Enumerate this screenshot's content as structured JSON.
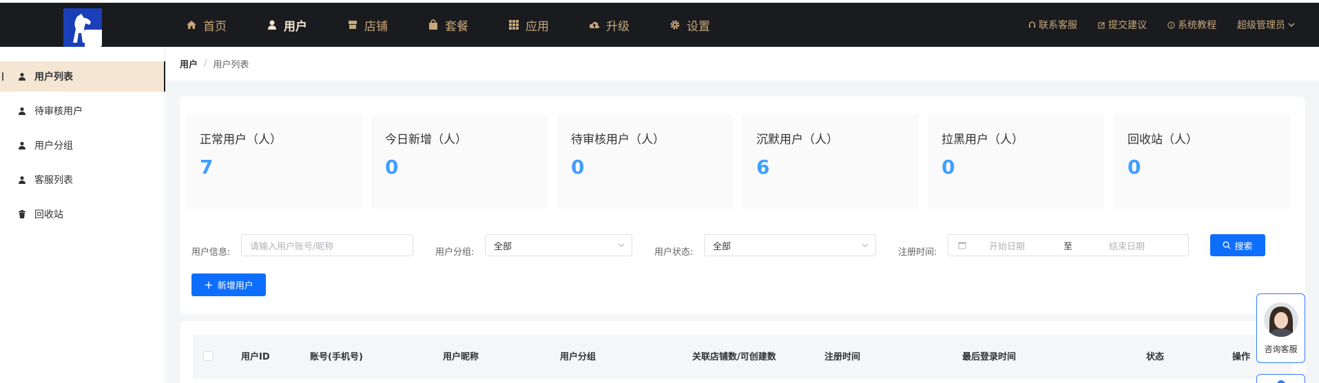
{
  "nav": {
    "items": [
      {
        "label": "首页",
        "icon": "home-icon"
      },
      {
        "label": "用户",
        "icon": "user-icon",
        "active": true
      },
      {
        "label": "店铺",
        "icon": "shop-icon"
      },
      {
        "label": "套餐",
        "icon": "package-icon"
      },
      {
        "label": "应用",
        "icon": "apps-grid-icon"
      },
      {
        "label": "升级",
        "icon": "cloud-upload-icon"
      },
      {
        "label": "设置",
        "icon": "gear-icon"
      }
    ],
    "right": [
      {
        "label": "联系客服",
        "icon": "headset-icon"
      },
      {
        "label": "提交建议",
        "icon": "edit-icon"
      },
      {
        "label": "系统教程",
        "icon": "info-icon"
      }
    ],
    "admin": "超级管理员"
  },
  "sidebar": {
    "items": [
      {
        "label": "用户列表",
        "icon": "user-icon",
        "active": true
      },
      {
        "label": "待审核用户",
        "icon": "user-icon"
      },
      {
        "label": "用户分组",
        "icon": "user-icon"
      },
      {
        "label": "客服列表",
        "icon": "user-icon"
      },
      {
        "label": "回收站",
        "icon": "trash-icon"
      }
    ]
  },
  "breadcrumb": {
    "root": "用户",
    "sep": "/",
    "current": "用户列表"
  },
  "stats": [
    {
      "label": "正常用户（人）",
      "value": "7"
    },
    {
      "label": "今日新增（人）",
      "value": "0"
    },
    {
      "label": "待审核用户（人）",
      "value": "0"
    },
    {
      "label": "沉默用户（人）",
      "value": "6"
    },
    {
      "label": "拉黑用户（人）",
      "value": "0"
    },
    {
      "label": "回收站（人）",
      "value": "0"
    }
  ],
  "filters": {
    "info_label": "用户信息:",
    "info_placeholder": "请输入用户账号/昵称",
    "group_label": "用户分组:",
    "group_value": "全部",
    "status_label": "用户状态:",
    "status_value": "全部",
    "time_label": "注册时间:",
    "start_placeholder": "开始日期",
    "range_sep": "至",
    "end_placeholder": "结束日期",
    "search_button": "搜索",
    "add_button": "新增用户"
  },
  "table": {
    "columns": [
      "用户ID",
      "账号(手机号)",
      "用户昵称",
      "用户分组",
      "关联店铺数/可创建数",
      "注册时间",
      "最后登录时间",
      "状态",
      "操作"
    ]
  },
  "float": {
    "cs_label": "咨询客服"
  },
  "colors": {
    "accent": "#409eff",
    "primary": "#0d6efd",
    "nav_bg": "#1a1b1f",
    "nav_text": "#c7a77a",
    "active_bg": "#f5e6d3"
  }
}
